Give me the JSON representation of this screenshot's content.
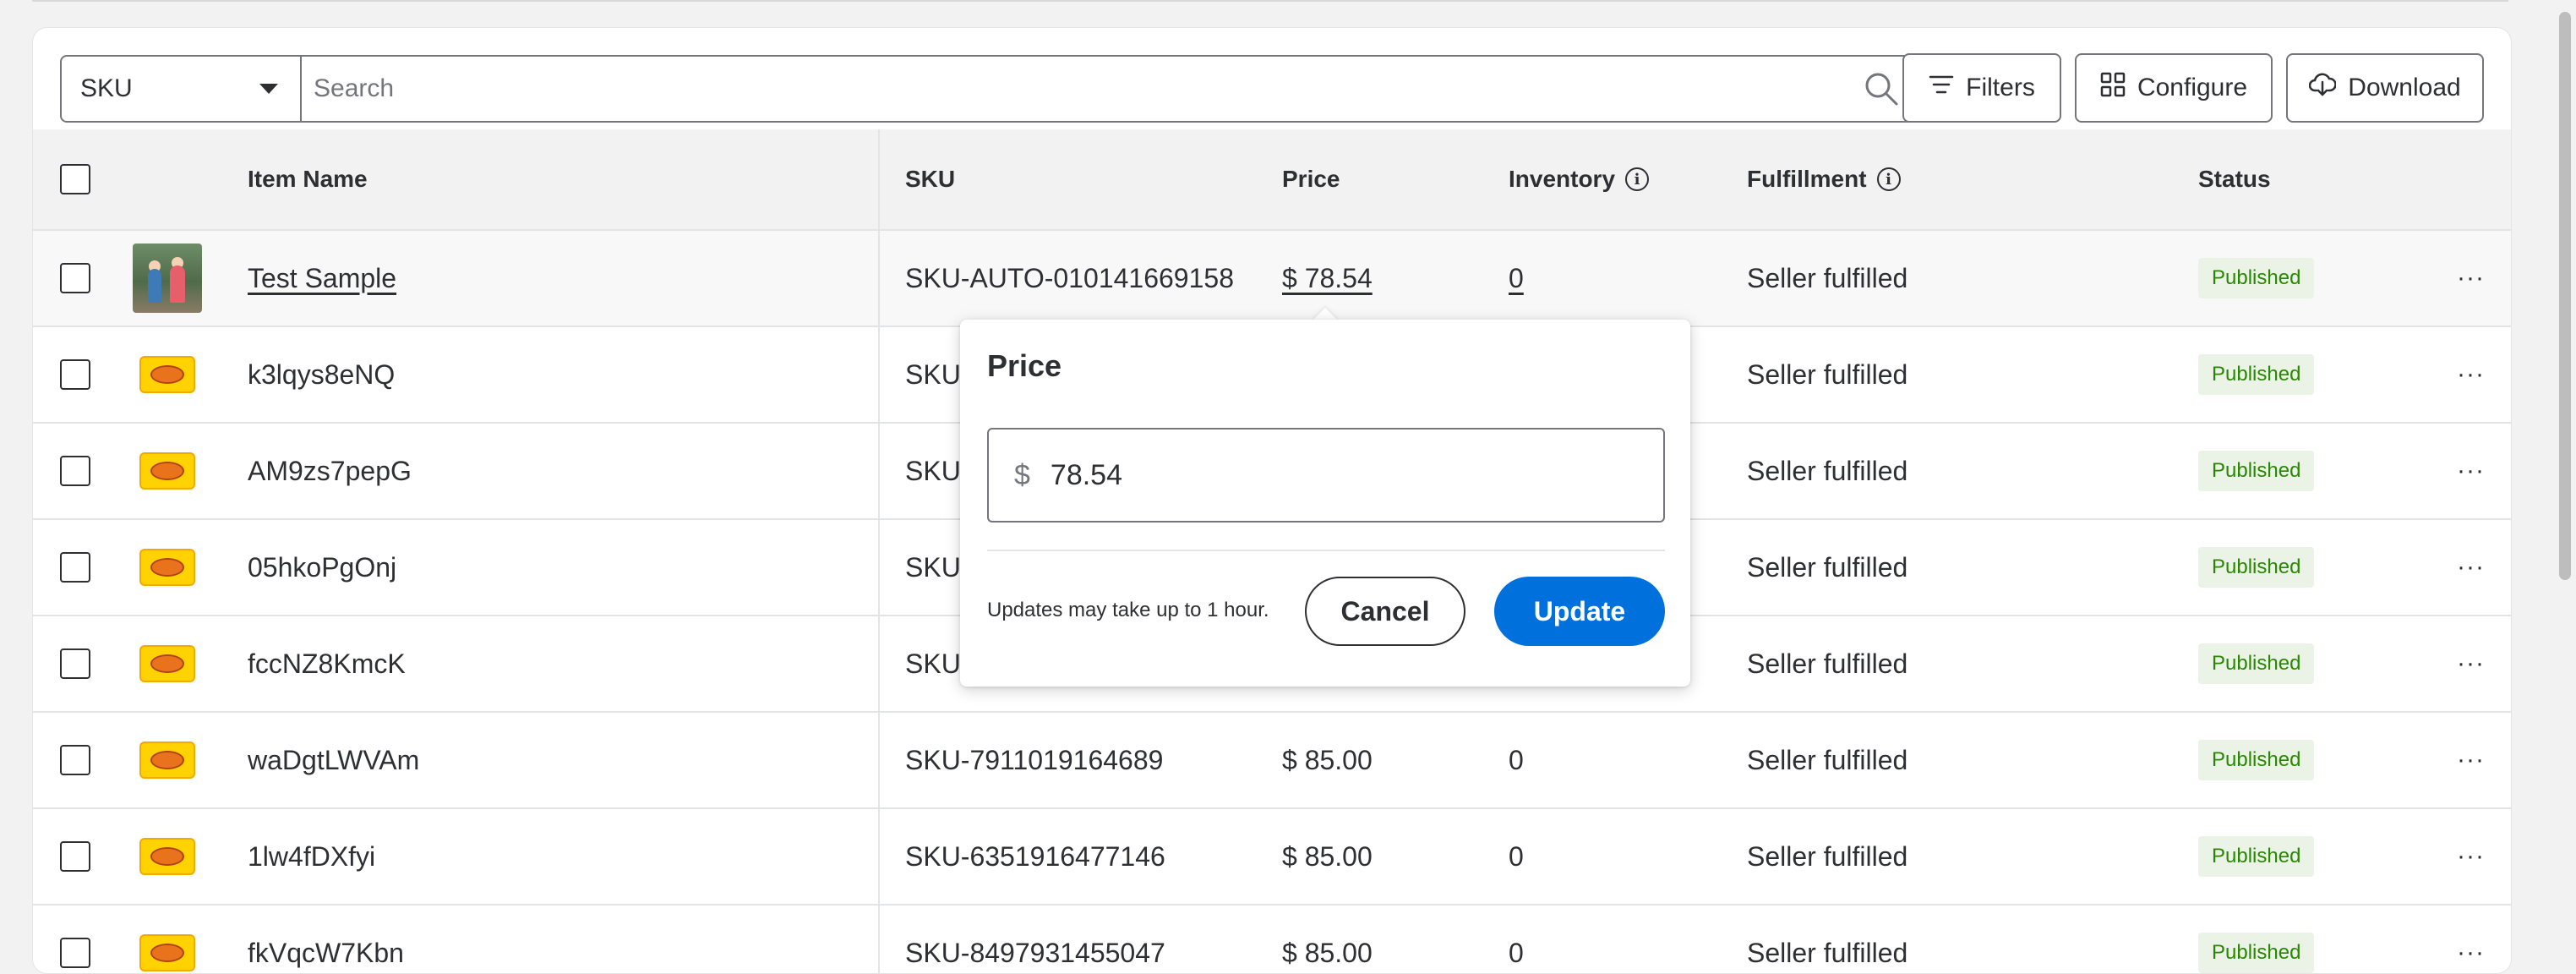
{
  "toolbar": {
    "field_select": "SKU",
    "search_placeholder": "Search",
    "filters_label": "Filters",
    "configure_label": "Configure",
    "download_label": "Download"
  },
  "columns": {
    "item_name": "Item Name",
    "sku": "SKU",
    "price": "Price",
    "inventory": "Inventory",
    "fulfillment": "Fulfillment",
    "status": "Status"
  },
  "rows": [
    {
      "name": "Test Sample",
      "sku": "SKU-AUTO-010141669158",
      "price": "$ 78.54",
      "inventory": "0",
      "fulfillment": "Seller fulfilled",
      "status": "Published",
      "thumb": "photo-thumbnail"
    },
    {
      "name": "k3lqys8eNQ",
      "sku": "SKU-",
      "price": "",
      "inventory": "",
      "fulfillment": "Seller fulfilled",
      "status": "Published",
      "thumb": "candy-thumbnail"
    },
    {
      "name": "AM9zs7pepG",
      "sku": "SKU-",
      "price": "",
      "inventory": "",
      "fulfillment": "Seller fulfilled",
      "status": "Published",
      "thumb": "candy-thumbnail"
    },
    {
      "name": "05hkoPgOnj",
      "sku": "SKU-",
      "price": "",
      "inventory": "",
      "fulfillment": "Seller fulfilled",
      "status": "Published",
      "thumb": "candy-thumbnail"
    },
    {
      "name": "fccNZ8KmcK",
      "sku": "SKU-",
      "price": "",
      "inventory": "",
      "fulfillment": "Seller fulfilled",
      "status": "Published",
      "thumb": "candy-thumbnail"
    },
    {
      "name": "waDgtLWVAm",
      "sku": "SKU-7911019164689",
      "price": "$ 85.00",
      "inventory": "0",
      "fulfillment": "Seller fulfilled",
      "status": "Published",
      "thumb": "candy-thumbnail"
    },
    {
      "name": "1lw4fDXfyi",
      "sku": "SKU-6351916477146",
      "price": "$ 85.00",
      "inventory": "0",
      "fulfillment": "Seller fulfilled",
      "status": "Published",
      "thumb": "candy-thumbnail"
    },
    {
      "name": "fkVqcW7Kbn",
      "sku": "SKU-8497931455047",
      "price": "$ 85.00",
      "inventory": "0",
      "fulfillment": "Seller fulfilled",
      "status": "Published",
      "thumb": "candy-thumbnail"
    }
  ],
  "price_popover": {
    "title": "Price",
    "currency_symbol": "$",
    "value": "78.54",
    "note": "Updates may take up to 1 hour.",
    "cancel_label": "Cancel",
    "update_label": "Update"
  },
  "colors": {
    "accent": "#0071dc",
    "published_bg": "#eaf3e6",
    "published_text": "#2a8703"
  },
  "icons": {
    "search": "search-icon",
    "filters": "filter-lines-icon",
    "configure": "grid-icon",
    "download": "cloud-download-icon",
    "info": "info-icon",
    "more": "more-horizontal-icon",
    "dropdown": "caret-down-icon"
  }
}
